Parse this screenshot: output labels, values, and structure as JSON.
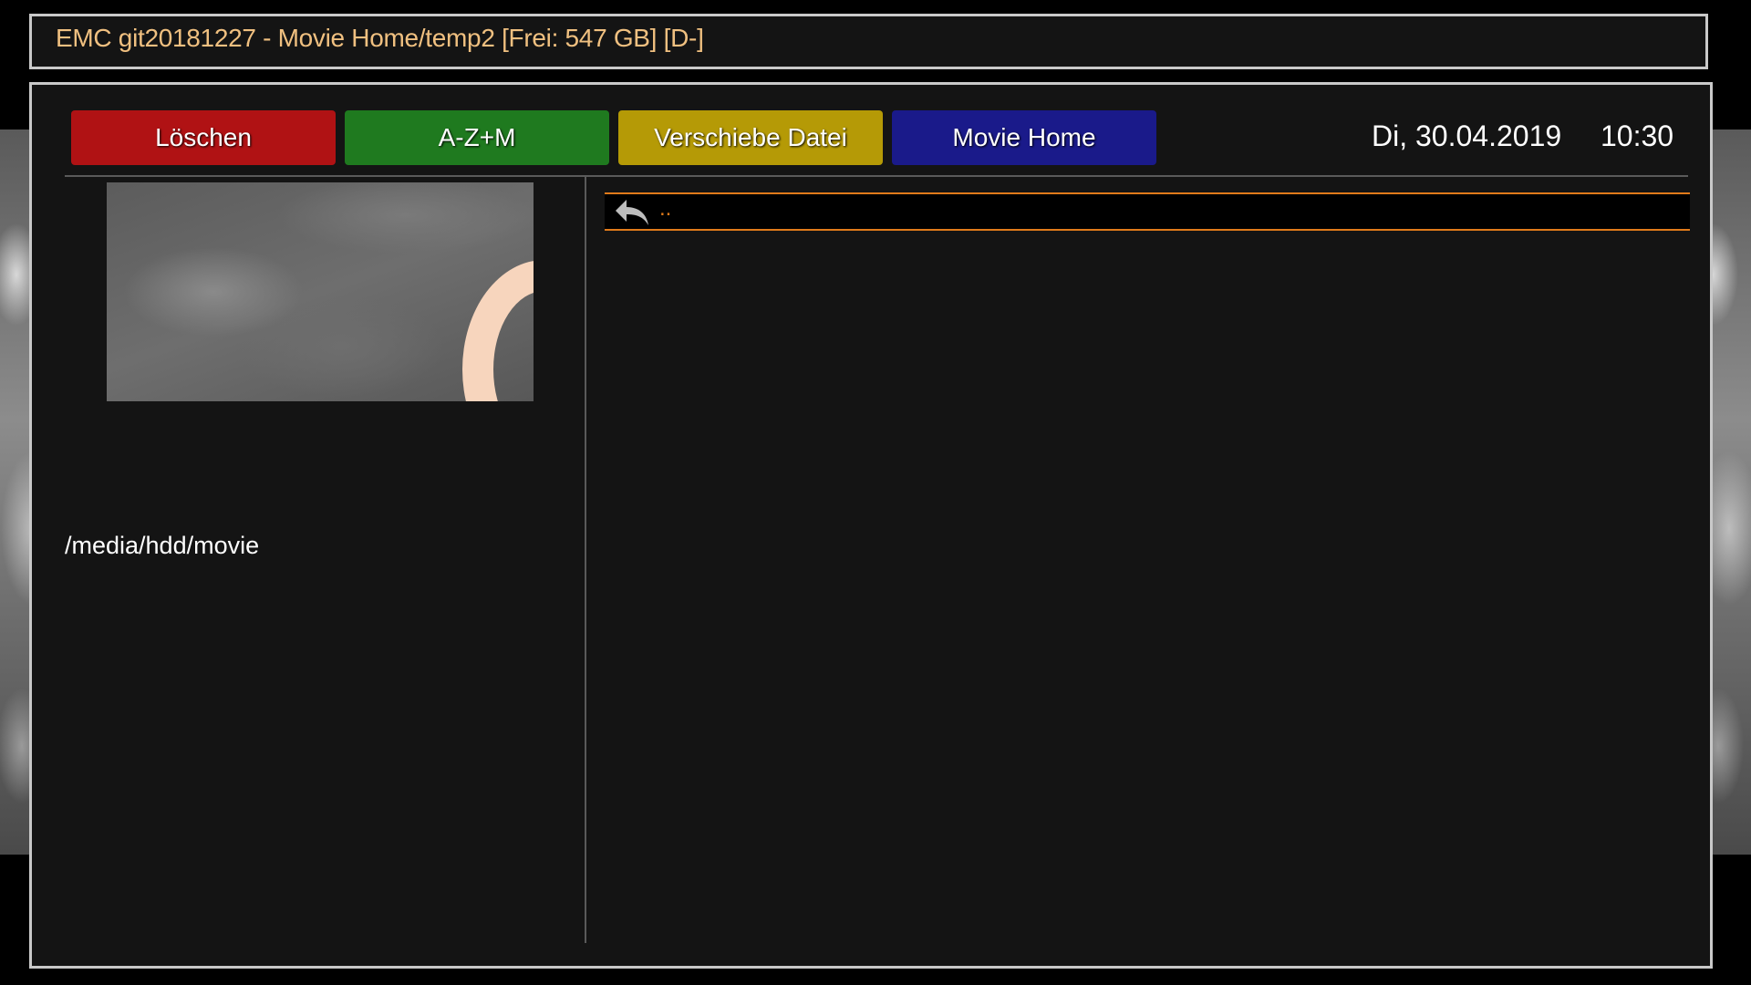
{
  "title_bar": {
    "text": "EMC git20181227 - Movie Home/temp2 [Frei: 547 GB] [D-]"
  },
  "buttons": {
    "red": "Löschen",
    "green": "A-Z+M",
    "yellow": "Verschiebe Datei",
    "blue": "Movie Home"
  },
  "clock": {
    "date": "Di, 30.04.2019",
    "time": "10:30"
  },
  "info": {
    "path": "/media/hdd/movie"
  },
  "list": {
    "items": [
      {
        "label": "..",
        "icon": "back-arrow-icon"
      }
    ]
  },
  "colors": {
    "title_text": "#f0c080",
    "selection_border": "#e07a1a",
    "red": "#b01214",
    "green": "#1f7a1f",
    "yellow": "#b59a06",
    "blue": "#1a1a8a"
  }
}
